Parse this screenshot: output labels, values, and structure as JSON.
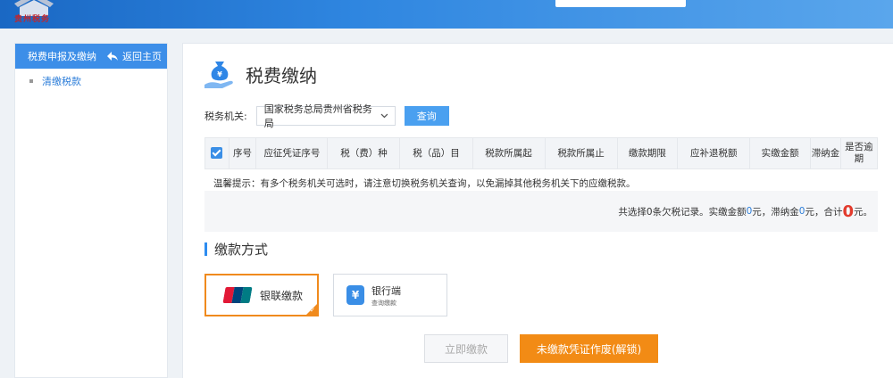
{
  "header": {
    "logo_text": "贵州税务",
    "icons": [
      "emblem-icon"
    ]
  },
  "sidebar": {
    "title": "税费申报及缴纳",
    "back_label": "返回主页",
    "items": [
      {
        "label": "清缴税款"
      }
    ]
  },
  "page": {
    "title": "税费缴纳",
    "filter": {
      "label": "税务机关:",
      "selected": "国家税务总局贵州省税务局",
      "query_button": "查询"
    },
    "table": {
      "headers": [
        "序号",
        "应征凭证序号",
        "税（费）种",
        "税（品）目",
        "税款所属起",
        "税款所属止",
        "缴款期限",
        "应补退税额",
        "实缴金额",
        "滞纳金",
        "是否逾期"
      ]
    },
    "tip": "温馨提示：有多个税务机关可选时，请注意切换税务机关查询，以免漏掉其他税务机关下的应缴税款。",
    "summary": {
      "prefix": "共选择0条欠税记录。实缴金额",
      "paid": "0",
      "mid1": "元，滞纳金",
      "late_fee": "0",
      "mid2": "元，合计",
      "total": "0",
      "suffix": "元。"
    },
    "payment_section_title": "缴款方式",
    "payment_methods": [
      {
        "label": "银联缴款",
        "logo_text": "UnionPay 银联",
        "selected": true
      },
      {
        "label": "银行端",
        "sub_label": "查询缴款",
        "selected": false
      }
    ],
    "buttons": {
      "pay_now": "立即缴款",
      "void_voucher": "未缴款凭证作废(解锁)"
    }
  },
  "colors": {
    "primary_blue": "#3c8ee8",
    "accent_orange": "#f28b15",
    "total_red": "#e23a2c"
  }
}
